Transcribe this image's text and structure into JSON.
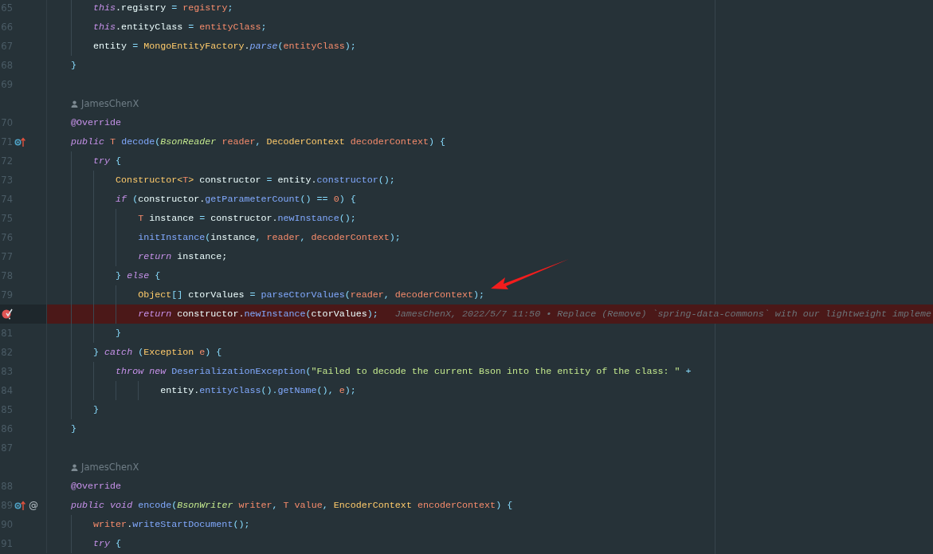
{
  "editor": {
    "lines": [
      {
        "kind": "block",
        "children": [
          {
            "kind": "code",
            "number": "65",
            "tokens": [
              {
                "kind": "keyword",
                "text": "this"
              },
              {
                "kind": "plain",
                "text": ".registry "
              },
              {
                "kind": "punct",
                "text": "= "
              },
              {
                "kind": "param",
                "text": "registry"
              },
              {
                "kind": "punct",
                "text": ";"
              }
            ]
          },
          {
            "kind": "code",
            "number": "66",
            "tokens": [
              {
                "kind": "keyword",
                "text": "this"
              },
              {
                "kind": "plain",
                "text": ".entityClass "
              },
              {
                "kind": "punct",
                "text": "= "
              },
              {
                "kind": "param",
                "text": "entityClass"
              },
              {
                "kind": "punct",
                "text": ";"
              }
            ]
          },
          {
            "kind": "code",
            "number": "67",
            "tokens": [
              {
                "kind": "plain",
                "text": "entity "
              },
              {
                "kind": "punct",
                "text": "= "
              },
              {
                "kind": "type",
                "text": "MongoEntityFactory"
              },
              {
                "kind": "plain",
                "text": "."
              },
              {
                "kind": "static",
                "text": "parse"
              },
              {
                "kind": "punct",
                "text": "("
              },
              {
                "kind": "param",
                "text": "entityClass"
              },
              {
                "kind": "punct",
                "text": ");"
              }
            ]
          }
        ]
      },
      {
        "kind": "code",
        "number": "68",
        "tokens": [
          {
            "kind": "punct",
            "text": "}"
          }
        ]
      },
      {
        "kind": "code",
        "number": "69"
      },
      {
        "kind": "author",
        "text": "JamesChenX"
      },
      {
        "kind": "code",
        "number": "70",
        "tokens": [
          {
            "kind": "annotation",
            "text": "@Override"
          }
        ]
      },
      {
        "kind": "code",
        "number": "71",
        "markers": [
          {
            "kind": "override"
          }
        ],
        "tokens": [
          {
            "kind": "keyword",
            "text": "public"
          },
          {
            "kind": "param",
            "text": " T"
          },
          {
            "kind": "method",
            "text": " decode"
          },
          {
            "kind": "punct",
            "text": "("
          },
          {
            "kind": "interface",
            "text": "BsonReader"
          },
          {
            "kind": "param",
            "text": " reader"
          },
          {
            "kind": "punct",
            "text": ", "
          },
          {
            "kind": "type",
            "text": "DecoderContext"
          },
          {
            "kind": "param",
            "text": " decoderContext"
          },
          {
            "kind": "punct",
            "text": ") {"
          }
        ],
        "children": [
          {
            "kind": "code",
            "number": "72",
            "tokens": [
              {
                "kind": "keyword",
                "text": "try"
              },
              {
                "kind": "punct",
                "text": " {"
              }
            ],
            "children": [
              {
                "kind": "code",
                "number": "73",
                "tokens": [
                  {
                    "kind": "type",
                    "text": "Constructor<"
                  },
                  {
                    "kind": "param",
                    "text": "T"
                  },
                  {
                    "kind": "type",
                    "text": ">"
                  },
                  {
                    "kind": "plain",
                    "text": " constructor "
                  },
                  {
                    "kind": "punct",
                    "text": "="
                  },
                  {
                    "kind": "plain",
                    "text": " entity."
                  },
                  {
                    "kind": "method",
                    "text": "constructor"
                  },
                  {
                    "kind": "punct",
                    "text": "();"
                  }
                ]
              },
              {
                "kind": "code",
                "number": "74",
                "tokens": [
                  {
                    "kind": "keyword",
                    "text": "if"
                  },
                  {
                    "kind": "punct",
                    "text": " ("
                  },
                  {
                    "kind": "plain",
                    "text": "constructor."
                  },
                  {
                    "kind": "method",
                    "text": "getParameterCount"
                  },
                  {
                    "kind": "punct",
                    "text": "() == "
                  },
                  {
                    "kind": "number",
                    "text": "0"
                  },
                  {
                    "kind": "punct",
                    "text": ") {"
                  }
                ],
                "children": [
                  {
                    "kind": "code",
                    "number": "75",
                    "tokens": [
                      {
                        "kind": "param",
                        "text": "T"
                      },
                      {
                        "kind": "plain",
                        "text": " instance "
                      },
                      {
                        "kind": "punct",
                        "text": "="
                      },
                      {
                        "kind": "plain",
                        "text": " constructor."
                      },
                      {
                        "kind": "method",
                        "text": "newInstance"
                      },
                      {
                        "kind": "punct",
                        "text": "();"
                      }
                    ]
                  },
                  {
                    "kind": "code",
                    "number": "76",
                    "tokens": [
                      {
                        "kind": "method",
                        "text": "initInstance"
                      },
                      {
                        "kind": "punct",
                        "text": "("
                      },
                      {
                        "kind": "plain",
                        "text": "instance"
                      },
                      {
                        "kind": "punct",
                        "text": ", "
                      },
                      {
                        "kind": "param",
                        "text": "reader"
                      },
                      {
                        "kind": "punct",
                        "text": ", "
                      },
                      {
                        "kind": "param",
                        "text": "decoderContext"
                      },
                      {
                        "kind": "punct",
                        "text": ");"
                      }
                    ]
                  },
                  {
                    "kind": "code",
                    "number": "77",
                    "tokens": [
                      {
                        "kind": "keyword",
                        "text": "return"
                      },
                      {
                        "kind": "plain",
                        "text": " instance;"
                      }
                    ]
                  }
                ]
              },
              {
                "kind": "code",
                "number": "78",
                "tokens": [
                  {
                    "kind": "punct",
                    "text": "} "
                  },
                  {
                    "kind": "keyword",
                    "text": "else"
                  },
                  {
                    "kind": "punct",
                    "text": " {"
                  }
                ],
                "children": [
                  {
                    "kind": "code",
                    "number": "79",
                    "tokens": [
                      {
                        "kind": "type",
                        "text": "Object"
                      },
                      {
                        "kind": "punct",
                        "text": "[]"
                      },
                      {
                        "kind": "plain",
                        "text": " ctorValues "
                      },
                      {
                        "kind": "punct",
                        "text": "= "
                      },
                      {
                        "kind": "method",
                        "text": "parseCtorValues"
                      },
                      {
                        "kind": "punct",
                        "text": "("
                      },
                      {
                        "kind": "param",
                        "text": "reader"
                      },
                      {
                        "kind": "punct",
                        "text": ", "
                      },
                      {
                        "kind": "param",
                        "text": "decoderContext"
                      },
                      {
                        "kind": "punct",
                        "text": ");"
                      }
                    ]
                  },
                  {
                    "kind": "code",
                    "highlighted": true,
                    "markers": [
                      {
                        "kind": "breakpoint"
                      }
                    ],
                    "tokens": [
                      {
                        "kind": "keyword",
                        "text": "return"
                      },
                      {
                        "kind": "plain",
                        "text": " constructor."
                      },
                      {
                        "kind": "method",
                        "text": "newInstance"
                      },
                      {
                        "kind": "punct",
                        "text": "("
                      },
                      {
                        "kind": "plain",
                        "text": "ctorValues"
                      },
                      {
                        "kind": "punct",
                        "text": ");"
                      }
                    ],
                    "blame": "JamesChenX, 2022/5/7 11:50 • Replace (Remove) `spring-data-commons` with our lightweight impleme"
                  }
                ]
              },
              {
                "kind": "code",
                "number": "81",
                "tokens": [
                  {
                    "kind": "punct",
                    "text": "}"
                  }
                ]
              }
            ]
          },
          {
            "kind": "code",
            "number": "82",
            "tokens": [
              {
                "kind": "punct",
                "text": "} "
              },
              {
                "kind": "keyword",
                "text": "catch"
              },
              {
                "kind": "punct",
                "text": " ("
              },
              {
                "kind": "type",
                "text": "Exception"
              },
              {
                "kind": "param",
                "text": " e"
              },
              {
                "kind": "punct",
                "text": ") {"
              }
            ],
            "children": [
              {
                "kind": "code",
                "number": "83",
                "tokens": [
                  {
                    "kind": "keyword",
                    "text": "throw new"
                  },
                  {
                    "kind": "method",
                    "text": " DeserializationException"
                  },
                  {
                    "kind": "punct",
                    "text": "("
                  },
                  {
                    "kind": "string",
                    "text": "\"Failed to decode the current Bson into the entity of the class: \""
                  },
                  {
                    "kind": "punct",
                    "text": " +"
                  }
                ],
                "children": [
                  {
                    "kind": "block",
                    "children": [
                      {
                        "kind": "code",
                        "number": "84",
                        "tokens": [
                          {
                            "kind": "plain",
                            "text": "entity."
                          },
                          {
                            "kind": "method",
                            "text": "entityClass"
                          },
                          {
                            "kind": "punct",
                            "text": "()."
                          },
                          {
                            "kind": "method",
                            "text": "getName"
                          },
                          {
                            "kind": "punct",
                            "text": "(), "
                          },
                          {
                            "kind": "param",
                            "text": "e"
                          },
                          {
                            "kind": "punct",
                            "text": ");"
                          }
                        ]
                      }
                    ]
                  }
                ]
              }
            ]
          },
          {
            "kind": "code",
            "number": "85",
            "tokens": [
              {
                "kind": "punct",
                "text": "}"
              }
            ]
          }
        ]
      },
      {
        "kind": "code",
        "number": "86",
        "tokens": [
          {
            "kind": "punct",
            "text": "}"
          }
        ]
      },
      {
        "kind": "code",
        "number": "87"
      },
      {
        "kind": "author",
        "text": "JamesChenX"
      },
      {
        "kind": "code",
        "number": "88",
        "tokens": [
          {
            "kind": "annotation",
            "text": "@Override"
          }
        ]
      },
      {
        "kind": "code",
        "number": "89",
        "markers": [
          {
            "kind": "override"
          },
          {
            "kind": "text",
            "text": "@"
          }
        ],
        "tokens": [
          {
            "kind": "keyword",
            "text": "public void"
          },
          {
            "kind": "method",
            "text": " encode"
          },
          {
            "kind": "punct",
            "text": "("
          },
          {
            "kind": "interface",
            "text": "BsonWriter"
          },
          {
            "kind": "param",
            "text": " writer"
          },
          {
            "kind": "punct",
            "text": ", "
          },
          {
            "kind": "param",
            "text": "T value"
          },
          {
            "kind": "punct",
            "text": ", "
          },
          {
            "kind": "type",
            "text": "EncoderContext"
          },
          {
            "kind": "param",
            "text": " encoderContext"
          },
          {
            "kind": "punct",
            "text": ") {"
          }
        ],
        "children": [
          {
            "kind": "code",
            "number": "90",
            "tokens": [
              {
                "kind": "param",
                "text": "writer"
              },
              {
                "kind": "plain",
                "text": "."
              },
              {
                "kind": "method",
                "text": "writeStartDocument"
              },
              {
                "kind": "punct",
                "text": "();"
              }
            ]
          },
          {
            "kind": "code",
            "number": "91",
            "tokens": [
              {
                "kind": "keyword",
                "text": "try"
              },
              {
                "kind": "punct",
                "text": " {"
              }
            ]
          }
        ]
      }
    ]
  }
}
